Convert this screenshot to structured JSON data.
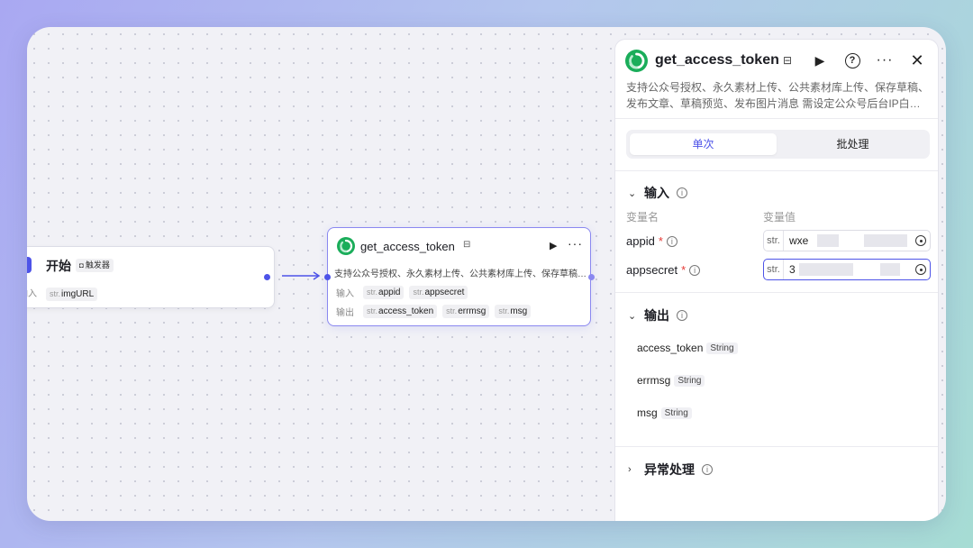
{
  "start_node": {
    "title": "开始",
    "trigger_badge": "触发器",
    "input_label": "输入",
    "inputs": [
      {
        "type": "str.",
        "name": "imgURL"
      }
    ]
  },
  "tool_node": {
    "title": "get_access_token",
    "description": "支持公众号授权、永久素材上传、公共素材库上传、保存草稿、发布文章、草稿预览、发布图片消息 需设定公众号后台IP白名单",
    "input_label": "输入",
    "output_label": "输出",
    "inputs": [
      {
        "type": "str.",
        "name": "appid"
      },
      {
        "type": "str.",
        "name": "appsecret"
      }
    ],
    "outputs": [
      {
        "type": "str.",
        "name": "access_token"
      },
      {
        "type": "str.",
        "name": "errmsg"
      },
      {
        "type": "str.",
        "name": "msg"
      }
    ]
  },
  "panel": {
    "title": "get_access_token",
    "description_line1": "支持公众号授权、永久素材上传、公共素材库上传、保存草稿、",
    "description_line2": "发布文章、草稿预览、发布图片消息 需设定公众号后台IP白…",
    "tabs": [
      {
        "label": "单次",
        "active": true
      },
      {
        "label": "批处理",
        "active": false
      }
    ],
    "input_section": {
      "title": "输入",
      "col_name": "变量名",
      "col_value": "变量值",
      "rows": [
        {
          "name": "appid",
          "required": "*",
          "type": "str.",
          "value": "wxe"
        },
        {
          "name": "appsecret",
          "required": "*",
          "type": "str.",
          "value": "3"
        }
      ]
    },
    "output_section": {
      "title": "输出",
      "rows": [
        {
          "name": "access_token",
          "type": "String"
        },
        {
          "name": "errmsg",
          "type": "String"
        },
        {
          "name": "msg",
          "type": "String"
        }
      ]
    },
    "exception_section": {
      "title": "异常处理"
    }
  },
  "colors": {
    "accent": "#4d53e8",
    "node_border_selected": "#8a88f0",
    "required": "#e53935",
    "logo_green": "#1aad5a"
  },
  "icons": {
    "start": "plugin-icon",
    "tool_logo": "wechat-logo-icon",
    "title_badge": "store-icon",
    "run": "play-icon",
    "help": "question-icon",
    "more": "more-icon",
    "close": "close-icon",
    "info": "info-icon",
    "target": "target-icon"
  }
}
